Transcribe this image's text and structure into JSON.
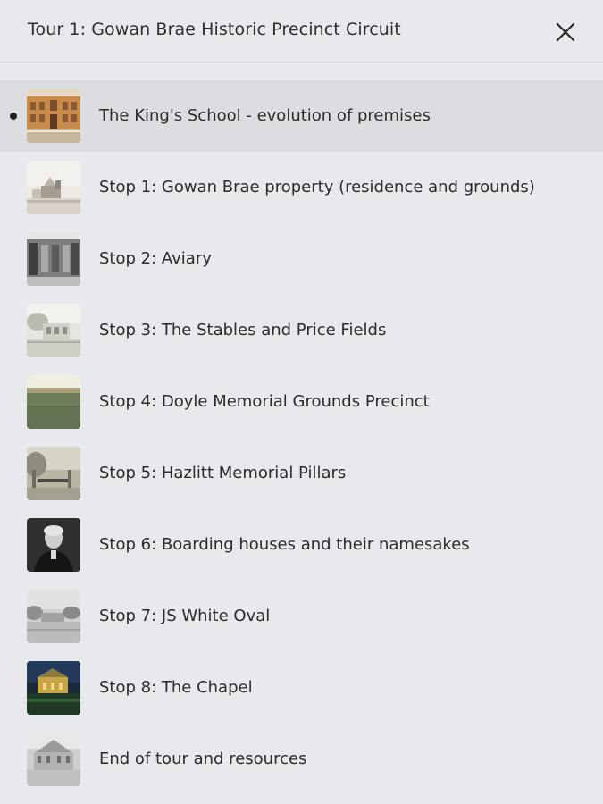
{
  "header": {
    "title": "Tour 1: Gowan Brae Historic Precinct Circuit",
    "close_icon": "close-icon"
  },
  "stops": [
    {
      "label": "The King's School - evolution of premises",
      "active": true,
      "thumb": "brick-building-photo"
    },
    {
      "label": "Stop 1: Gowan Brae property (residence and grounds)",
      "active": false,
      "thumb": "historic-residence-photo"
    },
    {
      "label": "Stop 2: Aviary",
      "active": false,
      "thumb": "aviary-photo"
    },
    {
      "label": "Stop 3: The Stables and Price Fields",
      "active": false,
      "thumb": "stables-photo"
    },
    {
      "label": "Stop 4: Doyle Memorial Grounds Precinct",
      "active": false,
      "thumb": "sports-field-photo"
    },
    {
      "label": "Stop 5: Hazlitt Memorial Pillars",
      "active": false,
      "thumb": "memorial-pillars-photo"
    },
    {
      "label": "Stop 6: Boarding houses and their namesakes",
      "active": false,
      "thumb": "portrait-photo"
    },
    {
      "label": "Stop 7: JS White Oval",
      "active": false,
      "thumb": "oval-photo"
    },
    {
      "label": "Stop 8: The Chapel",
      "active": false,
      "thumb": "chapel-night-photo"
    },
    {
      "label": "End of tour and resources",
      "active": false,
      "thumb": "archive-building-photo"
    }
  ]
}
